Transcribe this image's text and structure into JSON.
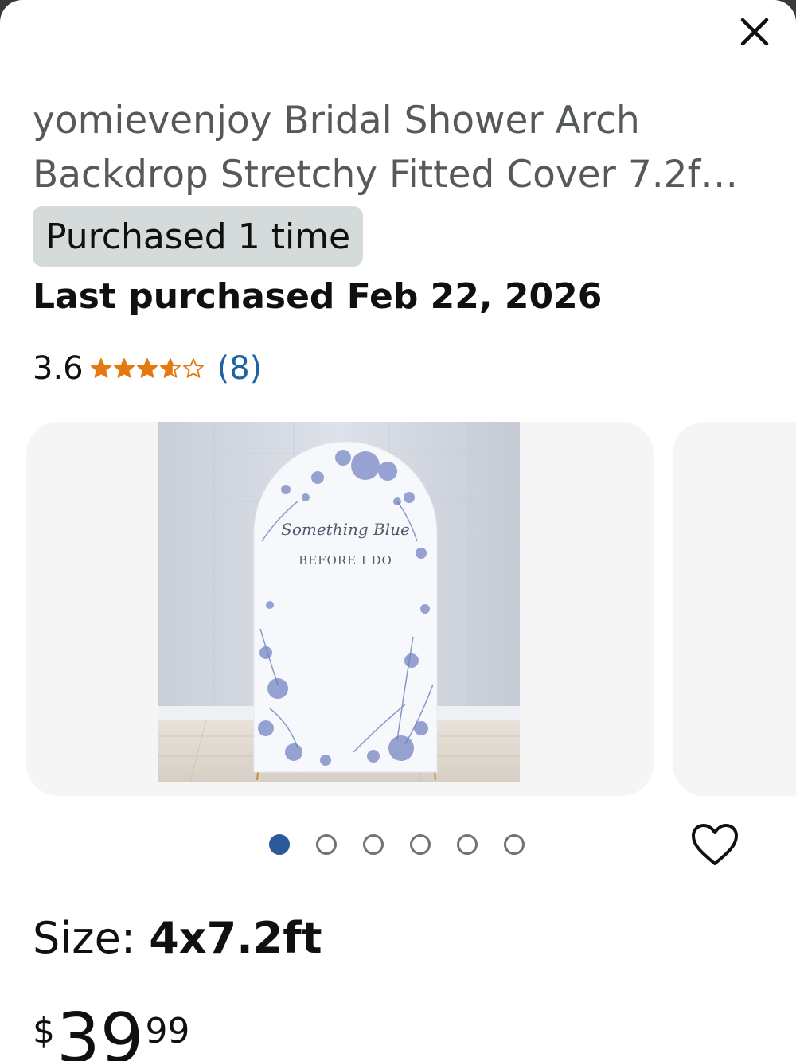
{
  "product": {
    "title_line1": "yomievenjoy Bridal Shower Arch",
    "title_line2": "Backdrop Stretchy Fitted Cover 7.2f…",
    "purchase_badge": "Purchased 1 time",
    "last_purchased": "Last purchased Feb 22, 2026",
    "rating": {
      "value": "3.6",
      "stars_value": 3.6,
      "stars_max": 5,
      "review_count": "(8)",
      "star_color": "#e47911"
    },
    "image": {
      "script_text": "Something Blue",
      "caption_text": "BEFORE I DO"
    },
    "carousel": {
      "total": 6,
      "active_index": 0,
      "active_color": "#2a5a9c"
    },
    "size": {
      "label": "Size: ",
      "value": "4x7.2ft"
    },
    "price": {
      "symbol": "$",
      "whole": "39",
      "fraction": "99"
    }
  },
  "icons": {
    "close": "close-icon",
    "heart": "heart-icon",
    "star": "star-icon"
  }
}
